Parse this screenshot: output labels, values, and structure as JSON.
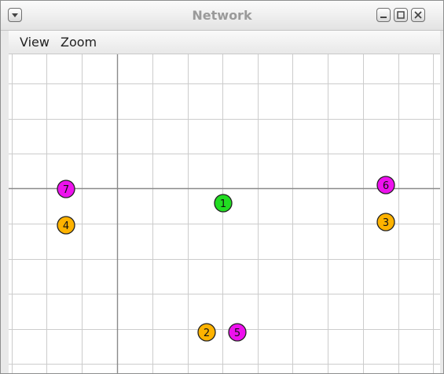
{
  "window": {
    "title": "Network"
  },
  "menu": {
    "items": [
      {
        "id": "view",
        "label": "View"
      },
      {
        "id": "zoom",
        "label": "Zoom"
      }
    ]
  },
  "colors": {
    "grid": "#cccccc",
    "axis": "#8a8a8a",
    "node_green": "#22dd22",
    "node_orange": "#ffb300",
    "node_magenta": "#ee11ee"
  },
  "nodes": [
    {
      "label": "1",
      "color": "green"
    },
    {
      "label": "2",
      "color": "orange"
    },
    {
      "label": "3",
      "color": "orange"
    },
    {
      "label": "4",
      "color": "orange"
    },
    {
      "label": "5",
      "color": "magenta"
    },
    {
      "label": "6",
      "color": "magenta"
    },
    {
      "label": "7",
      "color": "magenta"
    }
  ]
}
